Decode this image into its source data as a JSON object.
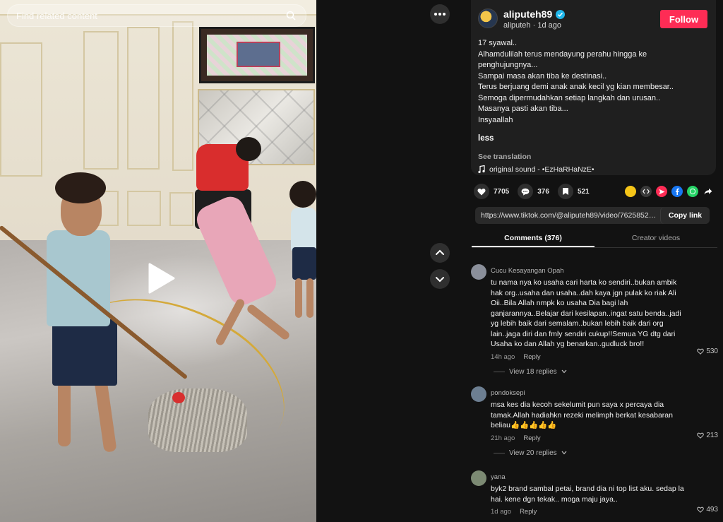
{
  "search": {
    "placeholder": "Find related content"
  },
  "post": {
    "author_name": "aliputeh89",
    "author_handle": "aliputeh",
    "posted": "1d ago",
    "follow_label": "Follow",
    "caption_lines": [
      "17 syawal..",
      "Alhamdulilah terus mendayung perahu hingga ke",
      "penghujungnya...",
      "Sampai masa akan tiba ke destinasi..",
      "Terus berjuang demi anak anak kecil yg kian membesar..",
      "Semoga dipermudahkan setiap langkah dan urusan..",
      "Masanya pasti akan tiba...",
      "Insyaallah"
    ],
    "less_label": "less",
    "see_translation": "See translation",
    "sound": "original sound - •EzHaRHaNzE•"
  },
  "stats": {
    "likes": "7705",
    "comments": "376",
    "saves": "521"
  },
  "share": {
    "link": "https://www.tiktok.com/@aliputeh89/video/762585201...",
    "copy_label": "Copy link"
  },
  "tabs": [
    {
      "label": "Comments (376)"
    },
    {
      "label": "Creator videos"
    }
  ],
  "comments": [
    {
      "user": "Cucu Kesayangan Opah",
      "text_lines": [
        "tu nama nya ko usaha cari harta ko sendiri..bukan ambik",
        "hak org..usaha dan usaha..dah kaya jgn pulak ko riak Ali",
        "Oii..Bila Allah nmpk ko usaha Dia bagi lah",
        "ganjarannya..Belajar dari kesilapan..ingat satu benda..jadi",
        "yg lebih baik dari semalam..bukan lebih baik dari org",
        "lain..jaga diri dan fmly sendiri cukup!!Semua YG dtg dari",
        "Usaha ko dan Allah yg benarkan..gudluck bro!!"
      ],
      "time": "14h ago",
      "reply_label": "Reply",
      "likes": "530",
      "view_replies": "View 18 replies",
      "avatar_color": "#8a8f9a"
    },
    {
      "user": "pondoksepi",
      "text_lines": [
        "msa kes dia kecoh sekelumit pun saya x percaya dia",
        "tamak.Allah hadiahkn rezeki melimph berkat kesabaran",
        "beliau👍👍👍👍👍"
      ],
      "time": "21h ago",
      "reply_label": "Reply",
      "likes": "213",
      "view_replies": "View 20 replies",
      "avatar_color": "#6d7f92"
    },
    {
      "user": "yana",
      "text_lines": [
        "byk2 brand sambal petai, brand dia ni top list aku. sedap la",
        "hai. kene dgn tekak.. moga maju jaya.."
      ],
      "time": "1d ago",
      "reply_label": "Reply",
      "likes": "493",
      "avatar_color": "#7c8a73"
    }
  ],
  "colors": {
    "accent": "#fe2c55",
    "verified": "#20b7eb",
    "panel_bg": "#1f1f1f",
    "page_bg": "#121212"
  },
  "icons": {
    "search": "search-icon",
    "play": "play-icon",
    "more": "more-icon",
    "up": "chevron-up-icon",
    "down": "chevron-down-icon",
    "heart": "heart-icon",
    "comment": "comment-icon",
    "bookmark": "bookmark-icon",
    "music": "music-note-icon"
  }
}
